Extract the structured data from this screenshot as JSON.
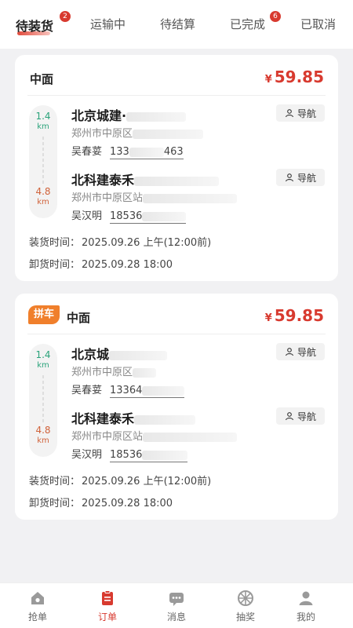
{
  "tabs": [
    {
      "label": "待装货",
      "badge": "2",
      "active": true
    },
    {
      "label": "运输中",
      "badge": "",
      "active": false
    },
    {
      "label": "待结算",
      "badge": "",
      "active": false
    },
    {
      "label": "已完成",
      "badge": "6",
      "active": false
    },
    {
      "label": "已取消",
      "badge": "",
      "active": false
    }
  ],
  "orders": [
    {
      "pin_badge": "",
      "vehicle": "中面",
      "price_symbol": "¥",
      "price": "59.85",
      "pickup": {
        "distance": "1.4",
        "unit": "km",
        "name": "北京城建·",
        "address": "郑州市中原区",
        "contact": "吴春荽",
        "phone_prefix": "133",
        "phone_suffix": "463"
      },
      "dropoff": {
        "distance": "4.8",
        "unit": "km",
        "name": "北科建泰禾",
        "address": "郑州市中原区站",
        "contact": "吴汉明",
        "phone_prefix": "18536",
        "phone_suffix": ""
      },
      "nav_label": "导航",
      "load_label": "装货时间：",
      "load_time": "2025.09.26 上午(12:00前)",
      "unload_label": "卸货时间：",
      "unload_time": "2025.09.28 18:00"
    },
    {
      "pin_badge": "拼车",
      "vehicle": "中面",
      "price_symbol": "¥",
      "price": "59.85",
      "pickup": {
        "distance": "1.4",
        "unit": "km",
        "name": "北京城",
        "address": "郑州市中原区",
        "contact": "吴春荽",
        "phone_prefix": "13364",
        "phone_suffix": ""
      },
      "dropoff": {
        "distance": "4.8",
        "unit": "km",
        "name": "北科建泰禾",
        "address": "郑州市中原区站",
        "contact": "吴汉明",
        "phone_prefix": "18536",
        "phone_suffix": ""
      },
      "nav_label": "导航",
      "load_label": "装货时间：",
      "load_time": "2025.09.26 上午(12:00前)",
      "unload_label": "卸货时间：",
      "unload_time": "2025.09.28 18:00"
    }
  ],
  "bottom_nav": [
    {
      "label": "抢单",
      "icon": "home-icon",
      "active": false
    },
    {
      "label": "订单",
      "icon": "order-icon",
      "active": true
    },
    {
      "label": "消息",
      "icon": "message-icon",
      "active": false
    },
    {
      "label": "抽奖",
      "icon": "lottery-wheel-icon",
      "active": false
    },
    {
      "label": "我的",
      "icon": "profile-icon",
      "active": false
    }
  ],
  "colors": {
    "accent": "#d83a2f",
    "green": "#2aa37a",
    "orange": "#d0623a",
    "pin_badge": "#f07f2b"
  }
}
